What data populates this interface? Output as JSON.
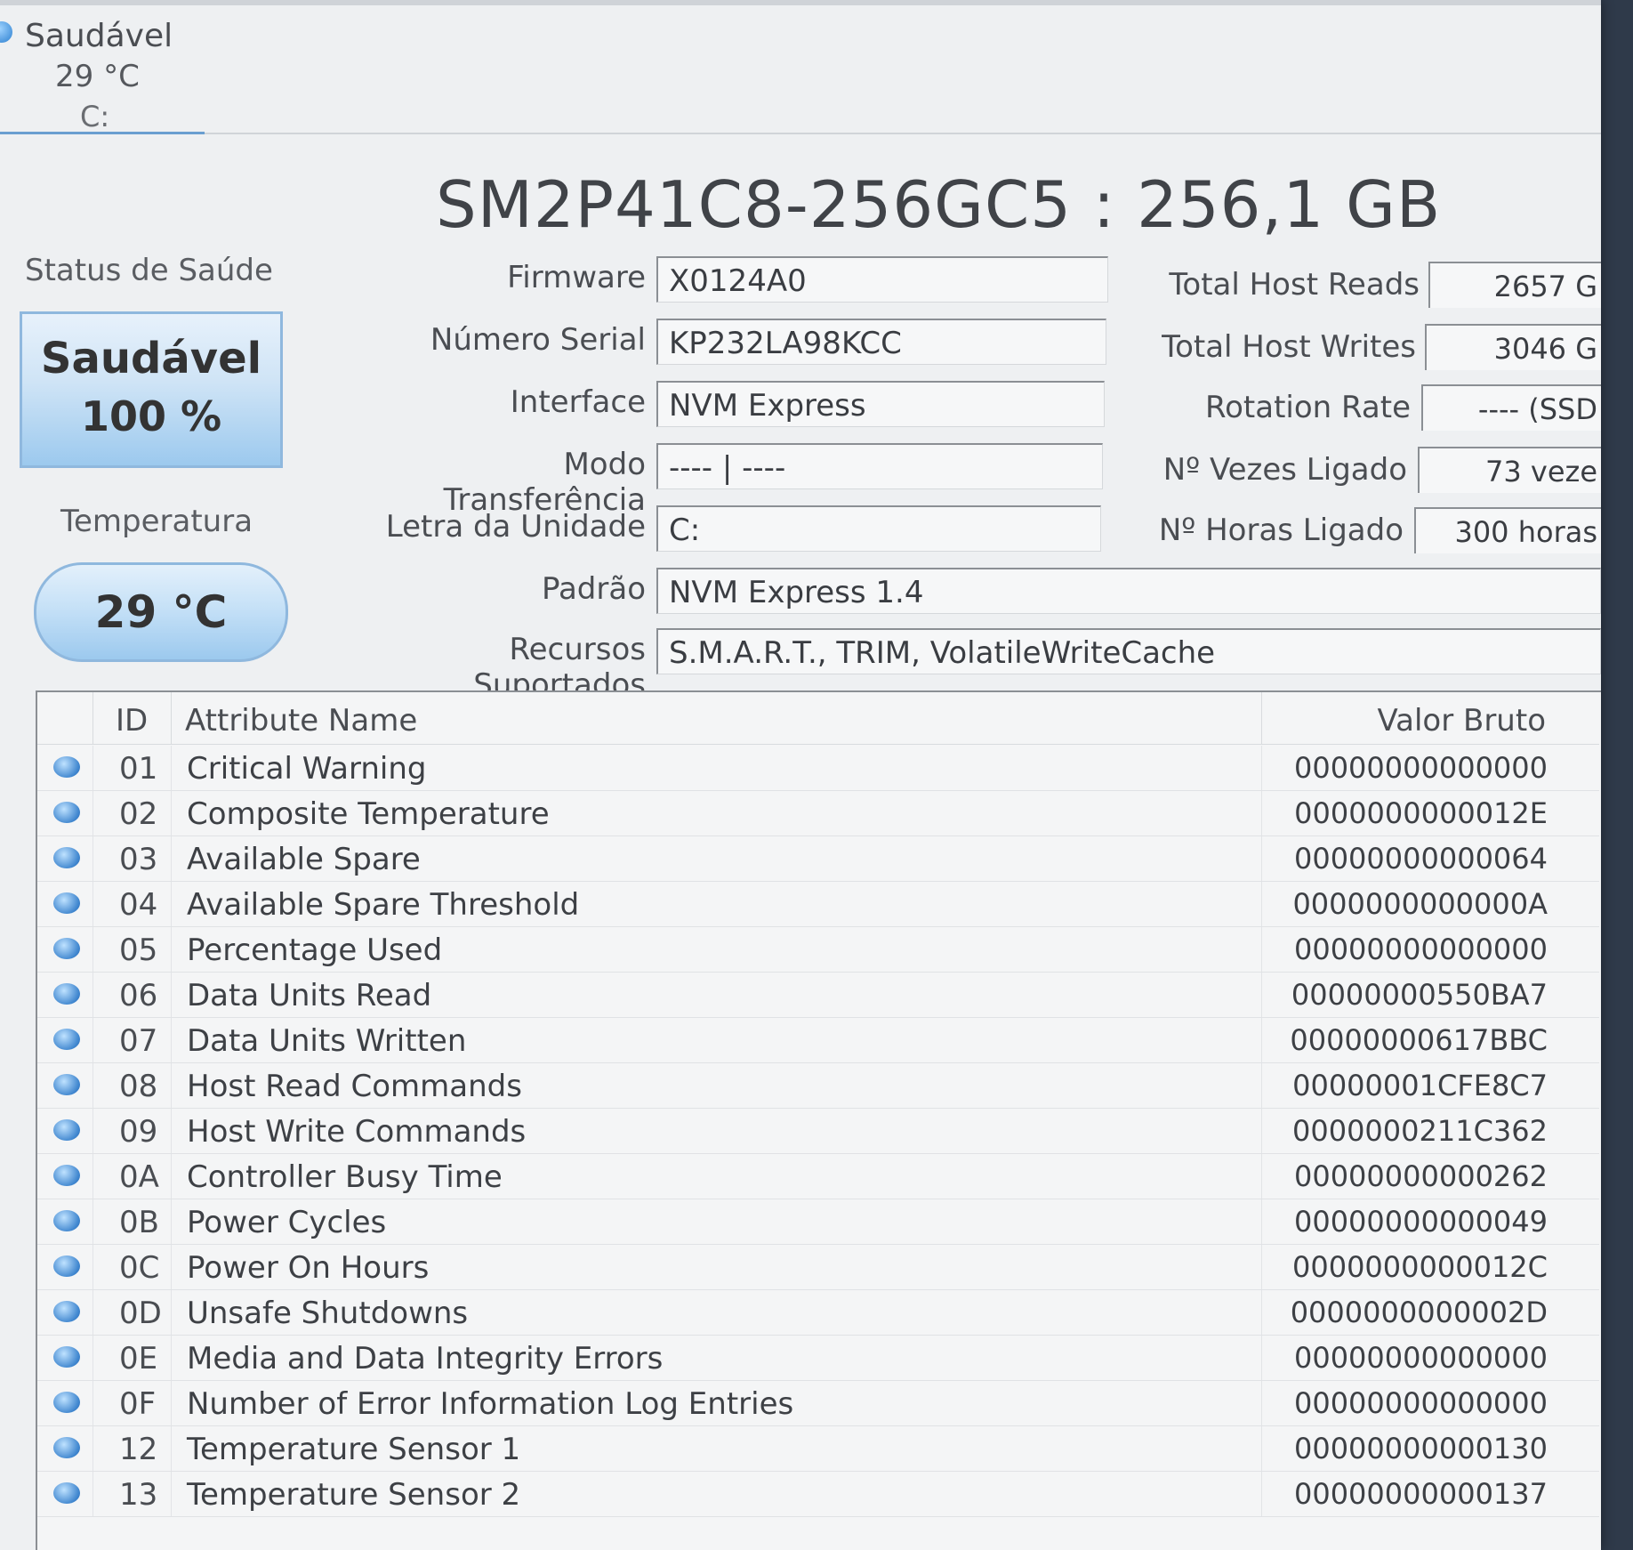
{
  "disk_tab": {
    "status": "Saudável",
    "temperature": "29 °C",
    "letter": "C:"
  },
  "drive_title": "SM2P41C8-256GC5 : 256,1 GB",
  "health": {
    "label": "Status de Saúde",
    "status": "Saudável",
    "percent": "100 %"
  },
  "temperature": {
    "label": "Temperatura",
    "value": "29 °C"
  },
  "fields": {
    "firmware": {
      "label": "Firmware",
      "value": "X0124A0"
    },
    "serial": {
      "label": "Número Serial",
      "value": "KP232LA98KCC"
    },
    "interface": {
      "label": "Interface",
      "value": "NVM Express"
    },
    "transfer_mode": {
      "label": "Modo Transferência",
      "value": "---- | ----"
    },
    "drive_letter": {
      "label": "Letra da Unidade",
      "value": "C:"
    },
    "standard": {
      "label": "Padrão",
      "value": "NVM Express 1.4"
    },
    "features": {
      "label": "Recursos Suportados",
      "value": "S.M.A.R.T., TRIM, VolatileWriteCache"
    }
  },
  "right_fields": {
    "host_reads": {
      "label": "Total Host Reads",
      "value": "2657 G"
    },
    "host_writes": {
      "label": "Total Host Writes",
      "value": "3046 G"
    },
    "rotation": {
      "label": "Rotation Rate",
      "value": "---- (SSD"
    },
    "power_count": {
      "label": "Nº Vezes Ligado",
      "value": "73 veze"
    },
    "power_hours": {
      "label": "Nº Horas Ligado",
      "value": "300 horas"
    }
  },
  "table": {
    "headers": {
      "id": "ID",
      "name": "Attribute Name",
      "raw": "Valor Bruto"
    },
    "rows": [
      {
        "id": "01",
        "name": "Critical Warning",
        "raw": "00000000000000"
      },
      {
        "id": "02",
        "name": "Composite Temperature",
        "raw": "0000000000012E"
      },
      {
        "id": "03",
        "name": "Available Spare",
        "raw": "00000000000064"
      },
      {
        "id": "04",
        "name": "Available Spare Threshold",
        "raw": "0000000000000A"
      },
      {
        "id": "05",
        "name": "Percentage Used",
        "raw": "00000000000000"
      },
      {
        "id": "06",
        "name": "Data Units Read",
        "raw": "00000000550BA7"
      },
      {
        "id": "07",
        "name": "Data Units Written",
        "raw": "00000000617BBC"
      },
      {
        "id": "08",
        "name": "Host Read Commands",
        "raw": "00000001CFE8C7"
      },
      {
        "id": "09",
        "name": "Host Write Commands",
        "raw": "0000000211C362"
      },
      {
        "id": "0A",
        "name": "Controller Busy Time",
        "raw": "00000000000262"
      },
      {
        "id": "0B",
        "name": "Power Cycles",
        "raw": "00000000000049"
      },
      {
        "id": "0C",
        "name": "Power On Hours",
        "raw": "0000000000012C"
      },
      {
        "id": "0D",
        "name": "Unsafe Shutdowns",
        "raw": "0000000000002D"
      },
      {
        "id": "0E",
        "name": "Media and Data Integrity Errors",
        "raw": "00000000000000"
      },
      {
        "id": "0F",
        "name": "Number of Error Information Log Entries",
        "raw": "00000000000000"
      },
      {
        "id": "12",
        "name": "Temperature Sensor 1",
        "raw": "00000000000130"
      },
      {
        "id": "13",
        "name": "Temperature Sensor 2",
        "raw": "00000000000137"
      }
    ]
  },
  "colors": {
    "accent_blue": "#3f86cf",
    "health_fill": "#9cc9ee",
    "window_bg": "#eef0f2"
  }
}
